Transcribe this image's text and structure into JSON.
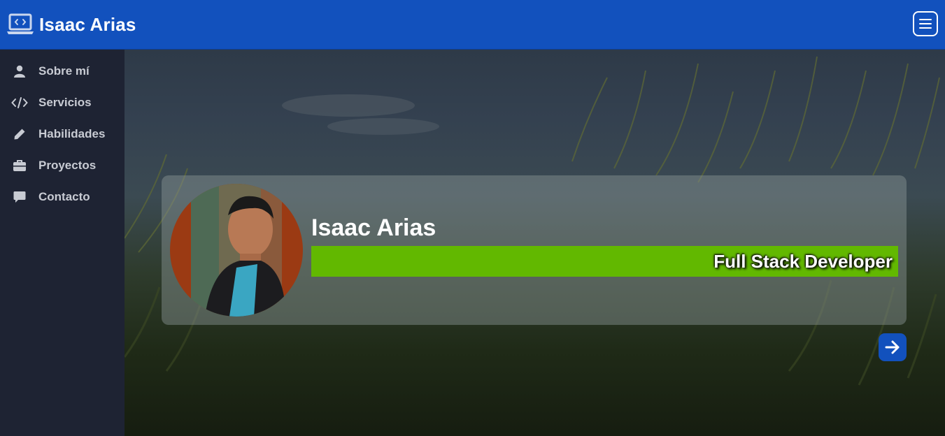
{
  "header": {
    "brand_icon": "laptop-code-icon",
    "title": "Isaac Arias",
    "menu_icon": "hamburger-menu-icon",
    "background_color": "#1251bd"
  },
  "sidebar": {
    "items": [
      {
        "label": "Sobre mí",
        "icon": "user-icon"
      },
      {
        "label": "Servicios",
        "icon": "code-icon"
      },
      {
        "label": "Habilidades",
        "icon": "pencil-icon"
      },
      {
        "label": "Proyectos",
        "icon": "briefcase-icon"
      },
      {
        "label": "Contacto",
        "icon": "comment-icon"
      }
    ]
  },
  "hero": {
    "name": "Isaac Arias",
    "role": "Full Stack Developer",
    "role_bar_color": "#62b800",
    "next_icon": "arrow-right-icon"
  }
}
